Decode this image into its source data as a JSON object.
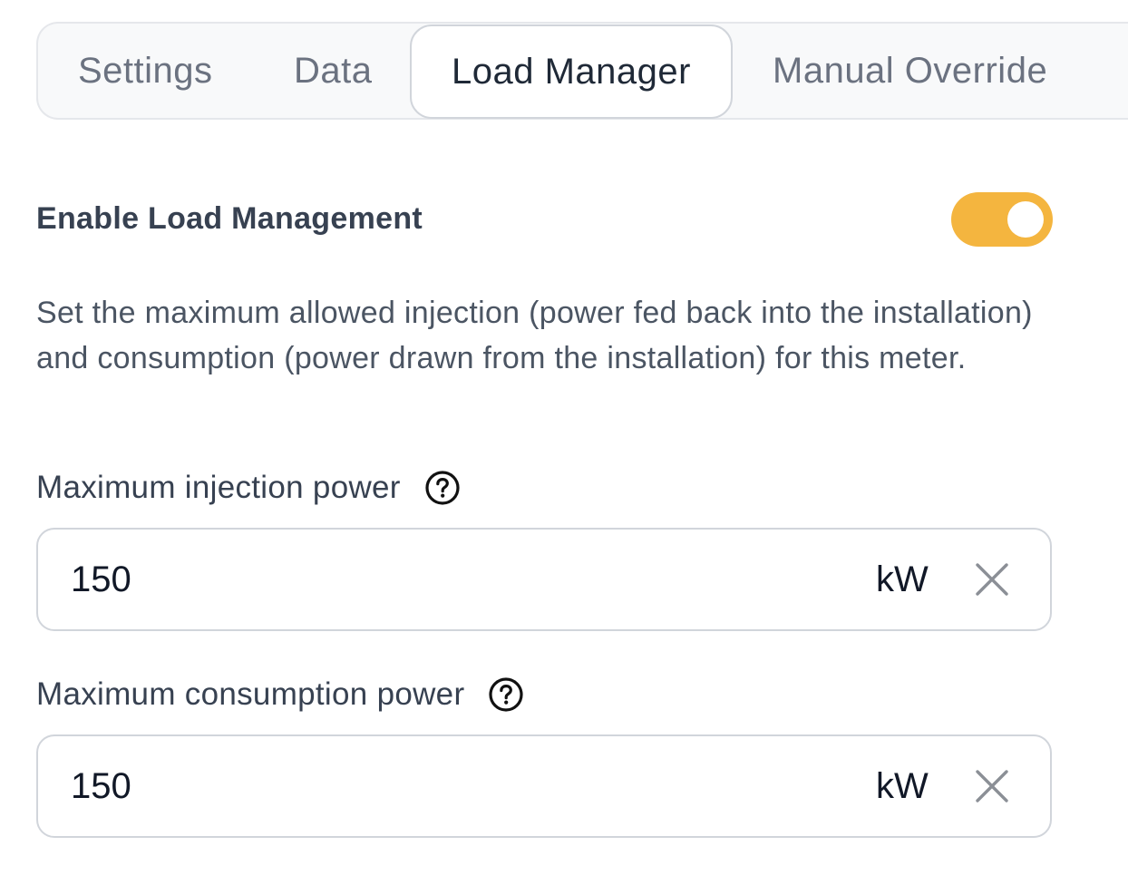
{
  "tabs": [
    {
      "label": "Settings",
      "active": false
    },
    {
      "label": "Data",
      "active": false
    },
    {
      "label": "Load Manager",
      "active": true
    },
    {
      "label": "Manual Override",
      "active": false
    }
  ],
  "load_management": {
    "label": "Enable Load Management",
    "enabled": true,
    "toggle_color": "#f4b53f",
    "description": "Set the maximum allowed injection (power fed back into the installation) and consumption (power drawn from the installation) for this meter."
  },
  "fields": {
    "injection": {
      "label": "Maximum injection power",
      "value": "150",
      "unit": "kW",
      "help_icon": "question-circle-icon",
      "clear_icon": "close-icon"
    },
    "consumption": {
      "label": "Maximum consumption power",
      "value": "150",
      "unit": "kW",
      "help_icon": "question-circle-icon",
      "clear_icon": "close-icon"
    }
  }
}
